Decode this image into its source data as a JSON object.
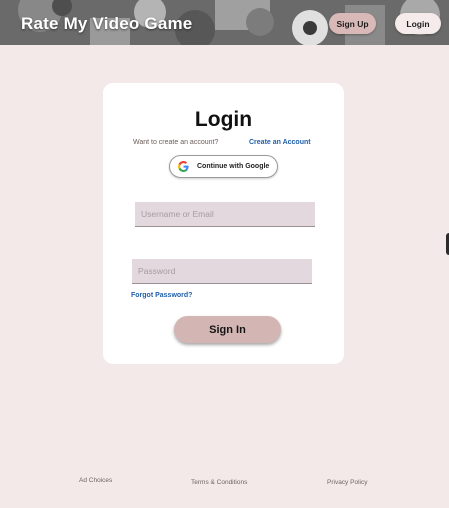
{
  "header": {
    "title": "Rate My Video Game",
    "signup_label": "Sign Up",
    "login_label": "Login"
  },
  "login_card": {
    "title": "Login",
    "create_prompt": "Want to create an account?",
    "create_link": "Create an Account",
    "google_label": "Continue with Google",
    "google_icon": "google-logo",
    "username_placeholder": "Username or Email",
    "password_placeholder": "Password",
    "forgot_link": "Forgot Password?",
    "signin_label": "Sign In"
  },
  "footer": {
    "ad_choices": "Ad Choices",
    "terms": "Terms & Conditions",
    "privacy": "Privacy Policy"
  },
  "colors": {
    "page_background": "#f3e9e8",
    "accent_button": "#d3b5b4",
    "link": "#1f5fa8",
    "input_background": "#e2d8de"
  }
}
